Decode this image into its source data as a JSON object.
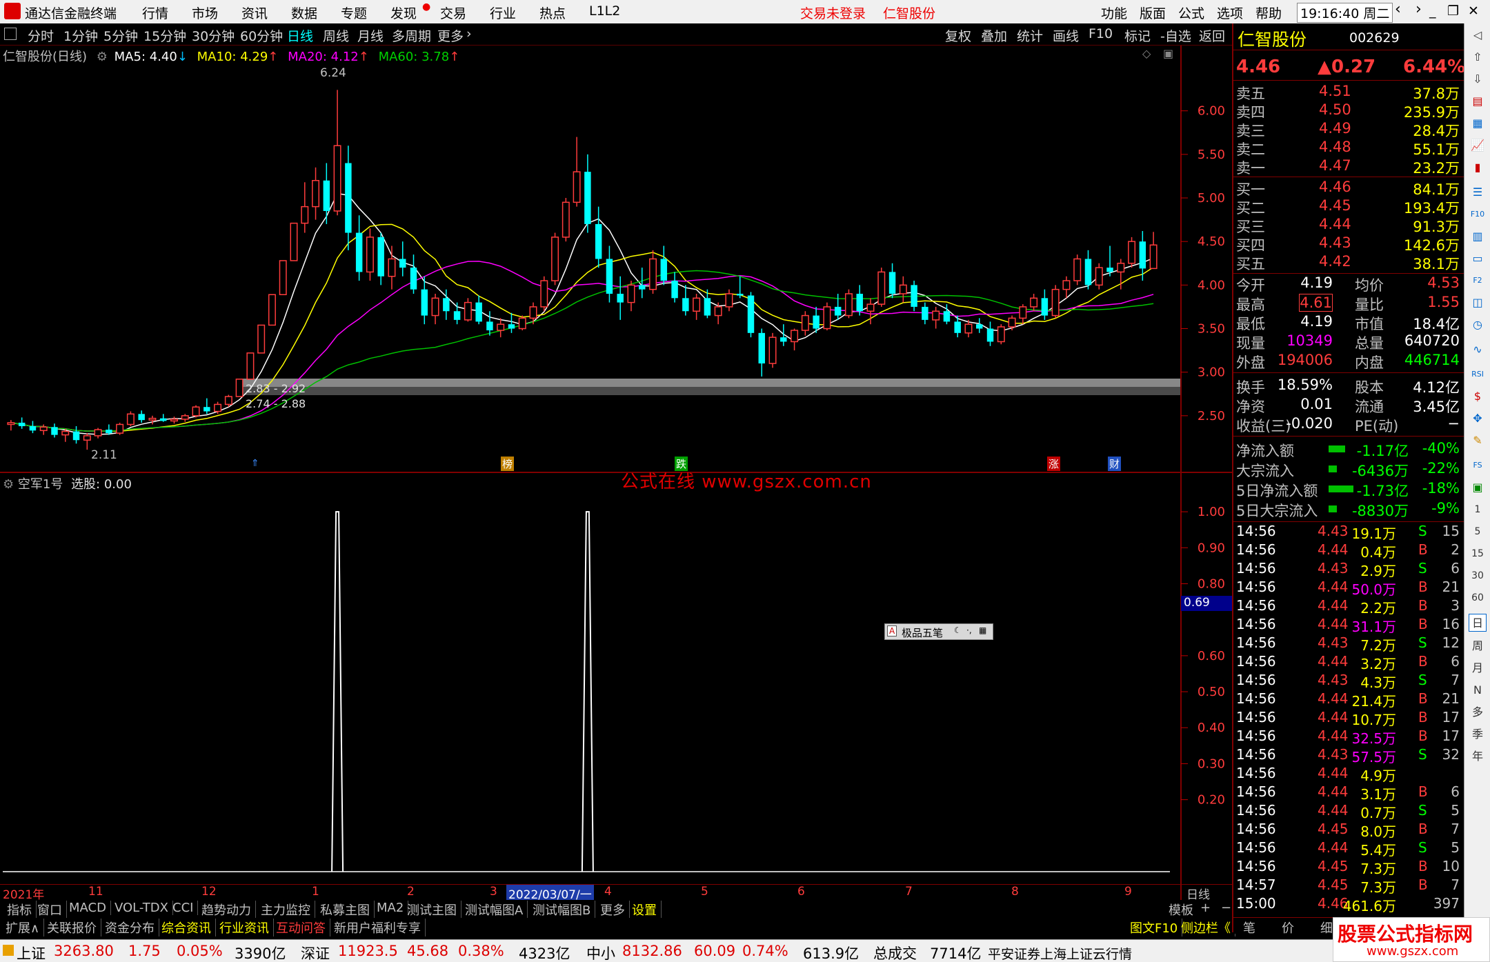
{
  "menubar": {
    "app_title": "通达信金融终端",
    "items": [
      "行情",
      "市场",
      "资讯",
      "数据",
      "专题",
      "发现",
      "交易",
      "行业",
      "热点",
      "L1L2"
    ],
    "login_status": "交易未登录",
    "stock_name": "仁智股份",
    "right_items": [
      "功能",
      "版面",
      "公式",
      "选项",
      "帮助"
    ],
    "time": "19:16:40",
    "weekday": "周二"
  },
  "periodbar": {
    "periods": [
      "分时",
      "1分钟",
      "5分钟",
      "15分钟",
      "30分钟",
      "60分钟",
      "日线",
      "周线",
      "月线",
      "多周期",
      "更多"
    ],
    "active": "日线",
    "tools": [
      "复权",
      "叠加",
      "统计",
      "画线",
      "F10",
      "标记",
      "-自选",
      "返回"
    ]
  },
  "kline": {
    "title": "仁智股份(日线)",
    "ma5": "MA5: 4.40",
    "ma10": "MA10: 4.29",
    "ma20": "MA20: 4.12",
    "ma60": "MA60: 3.78",
    "high_label": "6.24",
    "low_label": "2.11",
    "band_upper": "2.83 - 2.92",
    "band_lower": "2.74 - 2.88",
    "y_ticks": [
      "6.00",
      "5.50",
      "5.00",
      "4.50",
      "4.00",
      "3.50",
      "3.00",
      "2.50"
    ],
    "markers": [
      "榜",
      "跌",
      "涨",
      "财"
    ]
  },
  "indicator": {
    "title": "空军1号",
    "value_label": "选股: 0.00",
    "watermark": "公式在线  www.gszx.com.cn",
    "y_ticks": [
      "1.00",
      "0.90",
      "0.80",
      "0.69",
      "0.60",
      "0.50",
      "0.40",
      "0.30",
      "0.20"
    ],
    "cursor_value": "0.69"
  },
  "ime": {
    "label": "极品五笔"
  },
  "xaxis": {
    "labels": [
      "2021年",
      "11",
      "12",
      "1",
      "2",
      "3",
      "2022/03/07/一",
      "4",
      "5",
      "6",
      "7",
      "8",
      "9"
    ],
    "period": "日线"
  },
  "bottomtabs1": [
    "指标",
    "窗口",
    "MACD",
    "VOL-TDX",
    "CCI",
    "趋势动力",
    "主力监控",
    "私募主图",
    "MA2",
    "测试主图",
    "测试幅图A",
    "测试幅图B",
    "更多",
    "设置"
  ],
  "bottomtabs1_right": [
    "模板",
    "+",
    "−"
  ],
  "bottomtabs2": [
    "扩展∧",
    "关联报价",
    "资金分布",
    "综合资讯",
    "行业资讯",
    "互动问答",
    "新用户福利专享"
  ],
  "bottomtabs2_right": [
    "图文F10",
    "侧边栏《"
  ],
  "quote": {
    "name": "仁智股份",
    "code": "002629",
    "price": "4.46",
    "change": "▲0.27",
    "pct": "6.44%",
    "asks": [
      [
        "卖五",
        "4.51",
        "37.8万"
      ],
      [
        "卖四",
        "4.50",
        "235.9万"
      ],
      [
        "卖三",
        "4.49",
        "28.4万"
      ],
      [
        "卖二",
        "4.48",
        "55.1万"
      ],
      [
        "卖一",
        "4.47",
        "23.2万"
      ]
    ],
    "bids": [
      [
        "买一",
        "4.46",
        "84.1万"
      ],
      [
        "买二",
        "4.45",
        "193.4万"
      ],
      [
        "买三",
        "4.44",
        "91.3万"
      ],
      [
        "买四",
        "4.43",
        "142.6万"
      ],
      [
        "买五",
        "4.42",
        "38.1万"
      ]
    ],
    "stats": [
      [
        "今开",
        "4.19",
        "均价",
        "4.53"
      ],
      [
        "最高",
        "4.61",
        "量比",
        "1.55"
      ],
      [
        "最低",
        "4.19",
        "市值",
        "18.4亿"
      ],
      [
        "现量",
        "10349",
        "总量",
        "640720"
      ],
      [
        "外盘",
        "194006",
        "内盘",
        "446714"
      ]
    ],
    "stats2": [
      [
        "换手",
        "18.59%",
        "股本",
        "4.12亿"
      ],
      [
        "净资",
        "0.01",
        "流通",
        "3.45亿"
      ],
      [
        "收益(三)",
        "-0.020",
        "PE(动)",
        "−"
      ]
    ],
    "flows": [
      [
        "净流入额",
        "-1.17亿",
        "-40%"
      ],
      [
        "大宗流入",
        "-6436万",
        "-22%"
      ],
      [
        "5日净流入额",
        "-1.73亿",
        "-18%"
      ],
      [
        "5日大宗流入",
        "-8830万",
        "-9%"
      ]
    ],
    "ticks": [
      [
        "14:56",
        "4.43",
        "19.1万",
        "S",
        "15"
      ],
      [
        "14:56",
        "4.44",
        "0.4万",
        "B",
        "2"
      ],
      [
        "14:56",
        "4.43",
        "2.9万",
        "S",
        "6"
      ],
      [
        "14:56",
        "4.44",
        "50.0万",
        "B",
        "21"
      ],
      [
        "14:56",
        "4.44",
        "2.2万",
        "B",
        "3"
      ],
      [
        "14:56",
        "4.44",
        "31.1万",
        "B",
        "16"
      ],
      [
        "14:56",
        "4.43",
        "7.2万",
        "S",
        "12"
      ],
      [
        "14:56",
        "4.44",
        "3.2万",
        "B",
        "6"
      ],
      [
        "14:56",
        "4.43",
        "4.3万",
        "S",
        "7"
      ],
      [
        "14:56",
        "4.44",
        "21.4万",
        "B",
        "21"
      ],
      [
        "14:56",
        "4.44",
        "10.7万",
        "B",
        "17"
      ],
      [
        "14:56",
        "4.44",
        "32.5万",
        "B",
        "17"
      ],
      [
        "14:56",
        "4.43",
        "57.5万",
        "S",
        "32"
      ],
      [
        "14:56",
        "4.44",
        "4.9万",
        "",
        ""
      ],
      [
        "14:56",
        "4.44",
        "3.1万",
        "B",
        "6"
      ],
      [
        "14:56",
        "4.44",
        "0.7万",
        "S",
        "5"
      ],
      [
        "14:56",
        "4.45",
        "8.0万",
        "B",
        "7"
      ],
      [
        "14:56",
        "4.44",
        "5.4万",
        "S",
        "5"
      ],
      [
        "14:56",
        "4.45",
        "7.3万",
        "B",
        "10"
      ],
      [
        "14:57",
        "4.45",
        "7.3万",
        "B",
        "7"
      ],
      [
        "15:00",
        "4.46",
        "461.6万",
        "",
        "397"
      ]
    ],
    "tabs": [
      "笔",
      "价",
      "细",
      "势"
    ]
  },
  "sidetools": [
    "日",
    "周",
    "月",
    "N",
    "多",
    "季",
    "年"
  ],
  "statusbar": {
    "sh": "上证",
    "sh_val": "3263.80",
    "sh_chg": "1.75",
    "sh_pct": "0.05%",
    "sh_amt": "3390亿",
    "sz": "深证",
    "sz_val": "11923.5",
    "sz_chg": "45.68",
    "sz_pct": "0.38%",
    "sz_amt": "4323亿",
    "zx": "中小",
    "zx_val": "8132.86",
    "zx_chg": "60.09",
    "zx_pct": "0.74%",
    "zx_amt": "613.9亿",
    "total": "总成交",
    "total_val": "7714亿",
    "broker": "平安证券上海上证云行情",
    "logo": "股票公式指标网",
    "logo_url": "www.gszx.com"
  },
  "chart_data": {
    "type": "candlestick",
    "title": "仁智股份(日线)",
    "ylim": [
      2.0,
      6.3
    ],
    "indicator_ylim": [
      0,
      1.05
    ],
    "ohlc": [
      [
        2.4,
        2.45,
        2.33,
        2.42
      ],
      [
        2.42,
        2.48,
        2.35,
        2.38
      ],
      [
        2.38,
        2.44,
        2.3,
        2.33
      ],
      [
        2.33,
        2.4,
        2.28,
        2.37
      ],
      [
        2.37,
        2.41,
        2.25,
        2.28
      ],
      [
        2.28,
        2.35,
        2.2,
        2.32
      ],
      [
        2.32,
        2.38,
        2.18,
        2.22
      ],
      [
        2.22,
        2.3,
        2.11,
        2.27
      ],
      [
        2.27,
        2.36,
        2.24,
        2.34
      ],
      [
        2.34,
        2.4,
        2.28,
        2.3
      ],
      [
        2.3,
        2.42,
        2.28,
        2.4
      ],
      [
        2.4,
        2.55,
        2.38,
        2.52
      ],
      [
        2.52,
        2.56,
        2.42,
        2.45
      ],
      [
        2.45,
        2.5,
        2.4,
        2.47
      ],
      [
        2.47,
        2.52,
        2.43,
        2.44
      ],
      [
        2.44,
        2.49,
        2.41,
        2.46
      ],
      [
        2.46,
        2.52,
        2.43,
        2.5
      ],
      [
        2.5,
        2.62,
        2.48,
        2.6
      ],
      [
        2.6,
        2.7,
        2.52,
        2.55
      ],
      [
        2.55,
        2.66,
        2.52,
        2.63
      ],
      [
        2.63,
        2.74,
        2.6,
        2.72
      ],
      [
        2.72,
        2.92,
        2.72,
        2.92
      ],
      [
        2.92,
        3.22,
        2.92,
        3.22
      ],
      [
        3.22,
        3.54,
        3.22,
        3.54
      ],
      [
        3.54,
        3.89,
        3.54,
        3.89
      ],
      [
        3.89,
        4.28,
        3.89,
        4.28
      ],
      [
        4.28,
        4.71,
        4.28,
        4.71
      ],
      [
        4.71,
        5.18,
        4.6,
        4.9
      ],
      [
        4.9,
        5.35,
        4.75,
        5.2
      ],
      [
        5.2,
        5.4,
        4.7,
        4.85
      ],
      [
        4.85,
        6.24,
        4.8,
        5.6
      ],
      [
        5.4,
        5.6,
        4.4,
        4.6
      ],
      [
        4.6,
        4.8,
        4.05,
        4.15
      ],
      [
        4.15,
        4.65,
        4.05,
        4.55
      ],
      [
        4.55,
        4.6,
        4.0,
        4.1
      ],
      [
        4.1,
        4.45,
        3.95,
        4.3
      ],
      [
        4.3,
        4.5,
        4.1,
        4.2
      ],
      [
        4.2,
        4.35,
        3.9,
        3.95
      ],
      [
        3.95,
        4.1,
        3.55,
        3.65
      ],
      [
        3.65,
        3.9,
        3.55,
        3.85
      ],
      [
        3.85,
        3.95,
        3.6,
        3.7
      ],
      [
        3.7,
        3.8,
        3.55,
        3.6
      ],
      [
        3.6,
        3.85,
        3.58,
        3.8
      ],
      [
        3.8,
        3.88,
        3.55,
        3.58
      ],
      [
        3.58,
        3.7,
        3.42,
        3.48
      ],
      [
        3.48,
        3.62,
        3.4,
        3.55
      ],
      [
        3.55,
        3.68,
        3.45,
        3.5
      ],
      [
        3.5,
        3.65,
        3.48,
        3.62
      ],
      [
        3.62,
        3.8,
        3.55,
        3.75
      ],
      [
        3.75,
        4.1,
        3.7,
        4.05
      ],
      [
        4.05,
        4.6,
        4.0,
        4.55
      ],
      [
        4.55,
        5.0,
        4.5,
        4.95
      ],
      [
        4.95,
        5.7,
        4.9,
        5.3
      ],
      [
        5.3,
        5.5,
        4.6,
        4.7
      ],
      [
        4.7,
        4.9,
        4.2,
        4.3
      ],
      [
        4.3,
        4.45,
        3.8,
        3.9
      ],
      [
        3.9,
        4.1,
        3.6,
        3.8
      ],
      [
        3.8,
        4.05,
        3.7,
        4.0
      ],
      [
        4.0,
        4.2,
        3.85,
        3.95
      ],
      [
        3.95,
        4.4,
        3.9,
        4.3
      ],
      [
        4.3,
        4.45,
        4.0,
        4.05
      ],
      [
        4.05,
        4.15,
        3.8,
        3.85
      ],
      [
        3.85,
        4.0,
        3.65,
        3.7
      ],
      [
        3.7,
        3.9,
        3.6,
        3.85
      ],
      [
        3.85,
        3.95,
        3.62,
        3.65
      ],
      [
        3.65,
        3.8,
        3.55,
        3.75
      ],
      [
        3.75,
        3.95,
        3.7,
        3.9
      ],
      [
        3.9,
        4.1,
        3.85,
        3.88
      ],
      [
        3.88,
        3.92,
        3.4,
        3.45
      ],
      [
        3.45,
        3.5,
        2.95,
        3.1
      ],
      [
        3.1,
        3.45,
        3.05,
        3.4
      ],
      [
        3.4,
        3.55,
        3.3,
        3.35
      ],
      [
        3.35,
        3.5,
        3.25,
        3.48
      ],
      [
        3.48,
        3.7,
        3.42,
        3.65
      ],
      [
        3.65,
        3.75,
        3.45,
        3.5
      ],
      [
        3.5,
        3.8,
        3.48,
        3.75
      ],
      [
        3.75,
        3.9,
        3.6,
        3.65
      ],
      [
        3.65,
        3.95,
        3.62,
        3.9
      ],
      [
        3.9,
        4.0,
        3.65,
        3.7
      ],
      [
        3.7,
        3.85,
        3.55,
        3.78
      ],
      [
        3.78,
        4.2,
        3.75,
        4.15
      ],
      [
        4.15,
        4.25,
        3.85,
        3.9
      ],
      [
        3.9,
        4.1,
        3.8,
        4.0
      ],
      [
        4.0,
        4.05,
        3.7,
        3.75
      ],
      [
        3.75,
        3.8,
        3.55,
        3.6
      ],
      [
        3.6,
        3.75,
        3.5,
        3.7
      ],
      [
        3.7,
        3.78,
        3.55,
        3.58
      ],
      [
        3.58,
        3.65,
        3.4,
        3.45
      ],
      [
        3.45,
        3.6,
        3.4,
        3.55
      ],
      [
        3.55,
        3.62,
        3.45,
        3.5
      ],
      [
        3.5,
        3.58,
        3.3,
        3.35
      ],
      [
        3.35,
        3.55,
        3.32,
        3.52
      ],
      [
        3.52,
        3.65,
        3.48,
        3.62
      ],
      [
        3.62,
        3.78,
        3.55,
        3.75
      ],
      [
        3.75,
        3.9,
        3.7,
        3.85
      ],
      [
        3.85,
        3.95,
        3.6,
        3.65
      ],
      [
        3.65,
        4.0,
        3.62,
        3.95
      ],
      [
        3.95,
        4.1,
        3.85,
        4.05
      ],
      [
        4.05,
        4.35,
        4.0,
        4.3
      ],
      [
        4.3,
        4.4,
        3.95,
        4.0
      ],
      [
        4.0,
        4.25,
        3.95,
        4.2
      ],
      [
        4.2,
        4.45,
        4.1,
        4.15
      ],
      [
        4.15,
        4.3,
        3.95,
        4.25
      ],
      [
        4.25,
        4.55,
        4.2,
        4.5
      ],
      [
        4.5,
        4.62,
        4.05,
        4.19
      ],
      [
        4.19,
        4.61,
        4.19,
        4.46
      ]
    ],
    "signals": [
      {
        "index": 30,
        "value": 1.0
      },
      {
        "index": 53,
        "value": 1.0
      }
    ]
  }
}
